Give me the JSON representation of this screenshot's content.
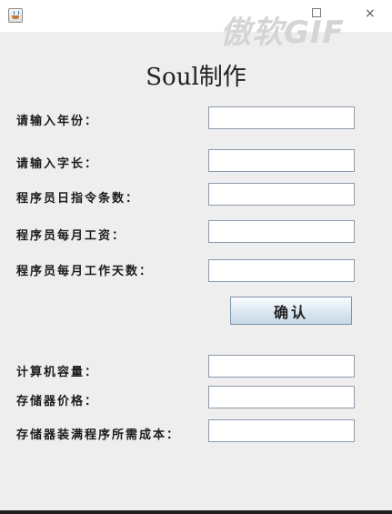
{
  "window": {
    "watermark": "傲软GIF",
    "close_glyph": "×"
  },
  "form": {
    "title": "Soul制作",
    "inputs": [
      {
        "label": "请输入年份：",
        "value": ""
      },
      {
        "label": "请输入字长：",
        "value": ""
      },
      {
        "label": "程序员日指令条数：",
        "value": ""
      },
      {
        "label": "程序员每月工资：",
        "value": ""
      },
      {
        "label": "程序员每月工作天数：",
        "value": ""
      }
    ],
    "confirm_label": "确认",
    "outputs": [
      {
        "label": "计算机容量：",
        "value": ""
      },
      {
        "label": "存储器价格：",
        "value": ""
      },
      {
        "label": "存储器装满程序所需成本：",
        "value": ""
      }
    ]
  },
  "icons": {
    "app": "java-app-icon",
    "minimize": "minimize-icon",
    "close": "close-icon"
  }
}
